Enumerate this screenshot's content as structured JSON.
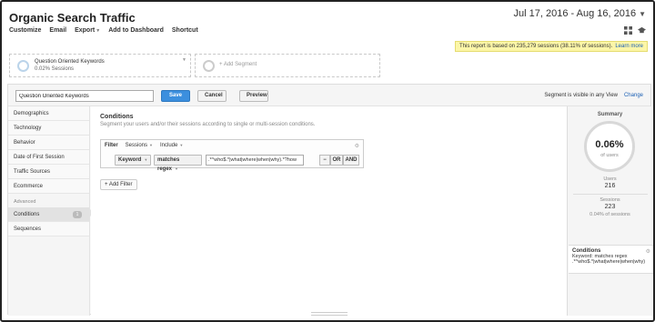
{
  "header": {
    "title": "Organic Search Traffic",
    "date_range": "Jul 17, 2016 - Aug 16, 2016"
  },
  "toolbar": {
    "items": [
      "Customize",
      "Email",
      "Export",
      "Add to Dashboard",
      "Shortcut"
    ]
  },
  "notice": {
    "text": "This report is based on 235,279 sessions (38.11% of sessions).",
    "link": "Learn more"
  },
  "segments": {
    "active": {
      "name": "Question Oriented Keywords",
      "sub": "0.02% Sessions"
    },
    "add_label": "+ Add Segment"
  },
  "editor": {
    "segment_name": "Question Oriented Keywords",
    "save_label": "Save",
    "cancel_label": "Cancel",
    "preview_label": "Preview",
    "visibility_text": "Segment is visible in any View",
    "change_label": "Change"
  },
  "sidebar": {
    "items": [
      "Demographics",
      "Technology",
      "Behavior",
      "Date of First Session",
      "Traffic Sources",
      "Ecommerce"
    ],
    "advanced_label": "Advanced",
    "advanced_items": [
      {
        "label": "Conditions",
        "badge": "1"
      },
      {
        "label": "Sequences"
      }
    ]
  },
  "conditions": {
    "title": "Conditions",
    "subtitle": "Segment your users and/or their sessions according to single or multi-session conditions.",
    "filter_label": "Filter",
    "scope": "Sessions",
    "mode": "Include",
    "dimension": "Keyword",
    "operator": "matches regex",
    "value": ".*^who$.*|what|where|when|why).*?how",
    "minus_label": "−",
    "or_label": "OR",
    "and_label": "AND",
    "add_filter_label": "+ Add Filter"
  },
  "summary": {
    "title": "Summary",
    "percent": "0.06%",
    "percent_label": "of users",
    "users_label": "Users",
    "users_value": "216",
    "sessions_label": "Sessions",
    "sessions_value": "223",
    "sessions_pct": "0.04% of sessions",
    "conditions_title": "Conditions",
    "conditions_line1": "Keyword: matches regex",
    "conditions_line2": ".*^who$.*|what|where|when|why)"
  }
}
